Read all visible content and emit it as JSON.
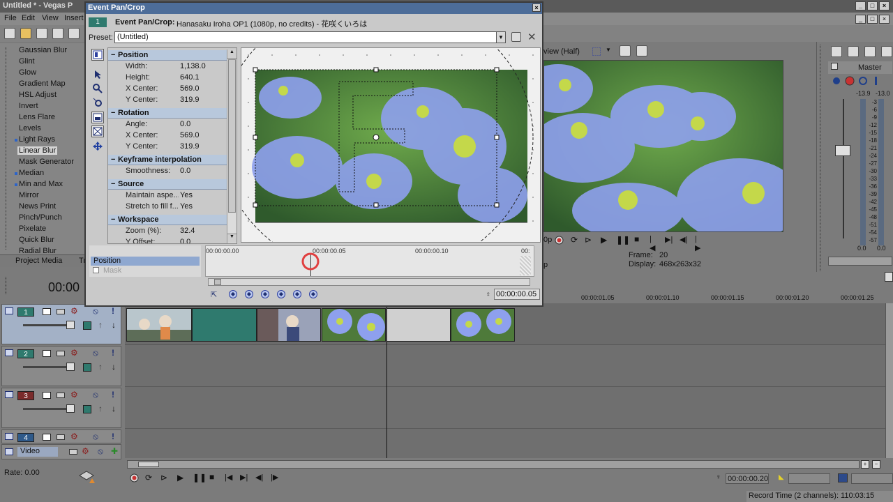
{
  "app": {
    "title": "Untitled * - Vegas P",
    "menu": [
      "File",
      "Edit",
      "View",
      "Insert"
    ]
  },
  "effects": {
    "items": [
      {
        "label": "Gaussian Blur",
        "bullet": false,
        "selected": false
      },
      {
        "label": "Glint",
        "bullet": false,
        "selected": false
      },
      {
        "label": "Glow",
        "bullet": false,
        "selected": false
      },
      {
        "label": "Gradient Map",
        "bullet": false,
        "selected": false
      },
      {
        "label": "HSL Adjust",
        "bullet": false,
        "selected": false
      },
      {
        "label": "Invert",
        "bullet": false,
        "selected": false
      },
      {
        "label": "Lens Flare",
        "bullet": false,
        "selected": false
      },
      {
        "label": "Levels",
        "bullet": false,
        "selected": false
      },
      {
        "label": "Light Rays",
        "bullet": true,
        "selected": false
      },
      {
        "label": "Linear Blur",
        "bullet": false,
        "selected": true
      },
      {
        "label": "Mask Generator",
        "bullet": false,
        "selected": false
      },
      {
        "label": "Median",
        "bullet": true,
        "selected": false
      },
      {
        "label": "Min and Max",
        "bullet": true,
        "selected": false
      },
      {
        "label": "Mirror",
        "bullet": false,
        "selected": false
      },
      {
        "label": "News Print",
        "bullet": false,
        "selected": false
      },
      {
        "label": "Pinch/Punch",
        "bullet": false,
        "selected": false
      },
      {
        "label": "Pixelate",
        "bullet": false,
        "selected": false
      },
      {
        "label": "Quick Blur",
        "bullet": false,
        "selected": false
      },
      {
        "label": "Radial Blur",
        "bullet": false,
        "selected": false
      }
    ],
    "tabs": [
      "Project Media",
      "Tr"
    ]
  },
  "dialog": {
    "title": "Event Pan/Crop",
    "badge": "1",
    "header_bold": "Event Pan/Crop:",
    "header_text": "Hanasaku Iroha OP1 (1080p, no credits) - 花咲くいろは",
    "preset_label": "Preset:",
    "preset_value": "(Untitled)",
    "groups": [
      {
        "title": "Position",
        "props": [
          {
            "name": "Width:",
            "value": "1,138.0"
          },
          {
            "name": "Height:",
            "value": "640.1"
          },
          {
            "name": "X Center:",
            "value": "569.0"
          },
          {
            "name": "Y Center:",
            "value": "319.9"
          }
        ]
      },
      {
        "title": "Rotation",
        "props": [
          {
            "name": "Angle:",
            "value": "0.0"
          },
          {
            "name": "X Center:",
            "value": "569.0"
          },
          {
            "name": "Y Center:",
            "value": "319.9"
          }
        ]
      },
      {
        "title": "Keyframe interpolation",
        "props": [
          {
            "name": "Smoothness:",
            "value": "0.0"
          }
        ]
      },
      {
        "title": "Source",
        "props": [
          {
            "name": "Maintain aspe...",
            "value": "Yes"
          },
          {
            "name": "Stretch to fill f...",
            "value": "Yes"
          }
        ]
      },
      {
        "title": "Workspace",
        "props": [
          {
            "name": "Zoom (%):",
            "value": "32.4"
          },
          {
            "name": "Y Offset:",
            "value": "0.0"
          }
        ]
      }
    ],
    "keyframes": {
      "tracks": [
        "Position",
        "Mask"
      ],
      "ruler": [
        "00:00:00.00",
        "00:00:00.05",
        "00:00:00.10",
        "00:"
      ],
      "time": "00:00:00.05"
    }
  },
  "preview": {
    "mode": "view (Half)",
    "frame_label": "Frame:",
    "frame_value": "20",
    "display_label": "Display:",
    "display_value": "468x263x32",
    "left_partial_1": "0p",
    "left_partial_2": "p"
  },
  "master": {
    "label": "Master",
    "left_peak": "-13.9",
    "right_peak": "-13.0",
    "scale": [
      "3",
      "6",
      "9",
      "12",
      "15",
      "18",
      "21",
      "24",
      "27",
      "30",
      "33",
      "36",
      "39",
      "42",
      "45",
      "48",
      "51",
      "54",
      "57"
    ],
    "bottom_left": "0.0",
    "bottom_right": "0.0"
  },
  "timeline": {
    "readout": "00:00",
    "ticks": [
      "00:00:01.05",
      "00:00:01.10",
      "00:00:01.15",
      "00:00:01.20",
      "00:00:01.25"
    ],
    "tracks": [
      {
        "num": "1",
        "color": "#2f7a6e"
      },
      {
        "num": "2",
        "color": "#2f7a6e"
      },
      {
        "num": "3",
        "color": "#7a2b2b"
      },
      {
        "num": "4",
        "color": "#2f5a8a"
      }
    ],
    "bus_label": "Video"
  },
  "transport": {
    "rate": "Rate: 0.00",
    "time": "00:00:00.20",
    "status": "Record Time (2 channels): 110:03:15"
  },
  "colors": {
    "accent": "#4d6d99",
    "track_teal": "#2f7a6e",
    "record_red": "#c83232"
  }
}
